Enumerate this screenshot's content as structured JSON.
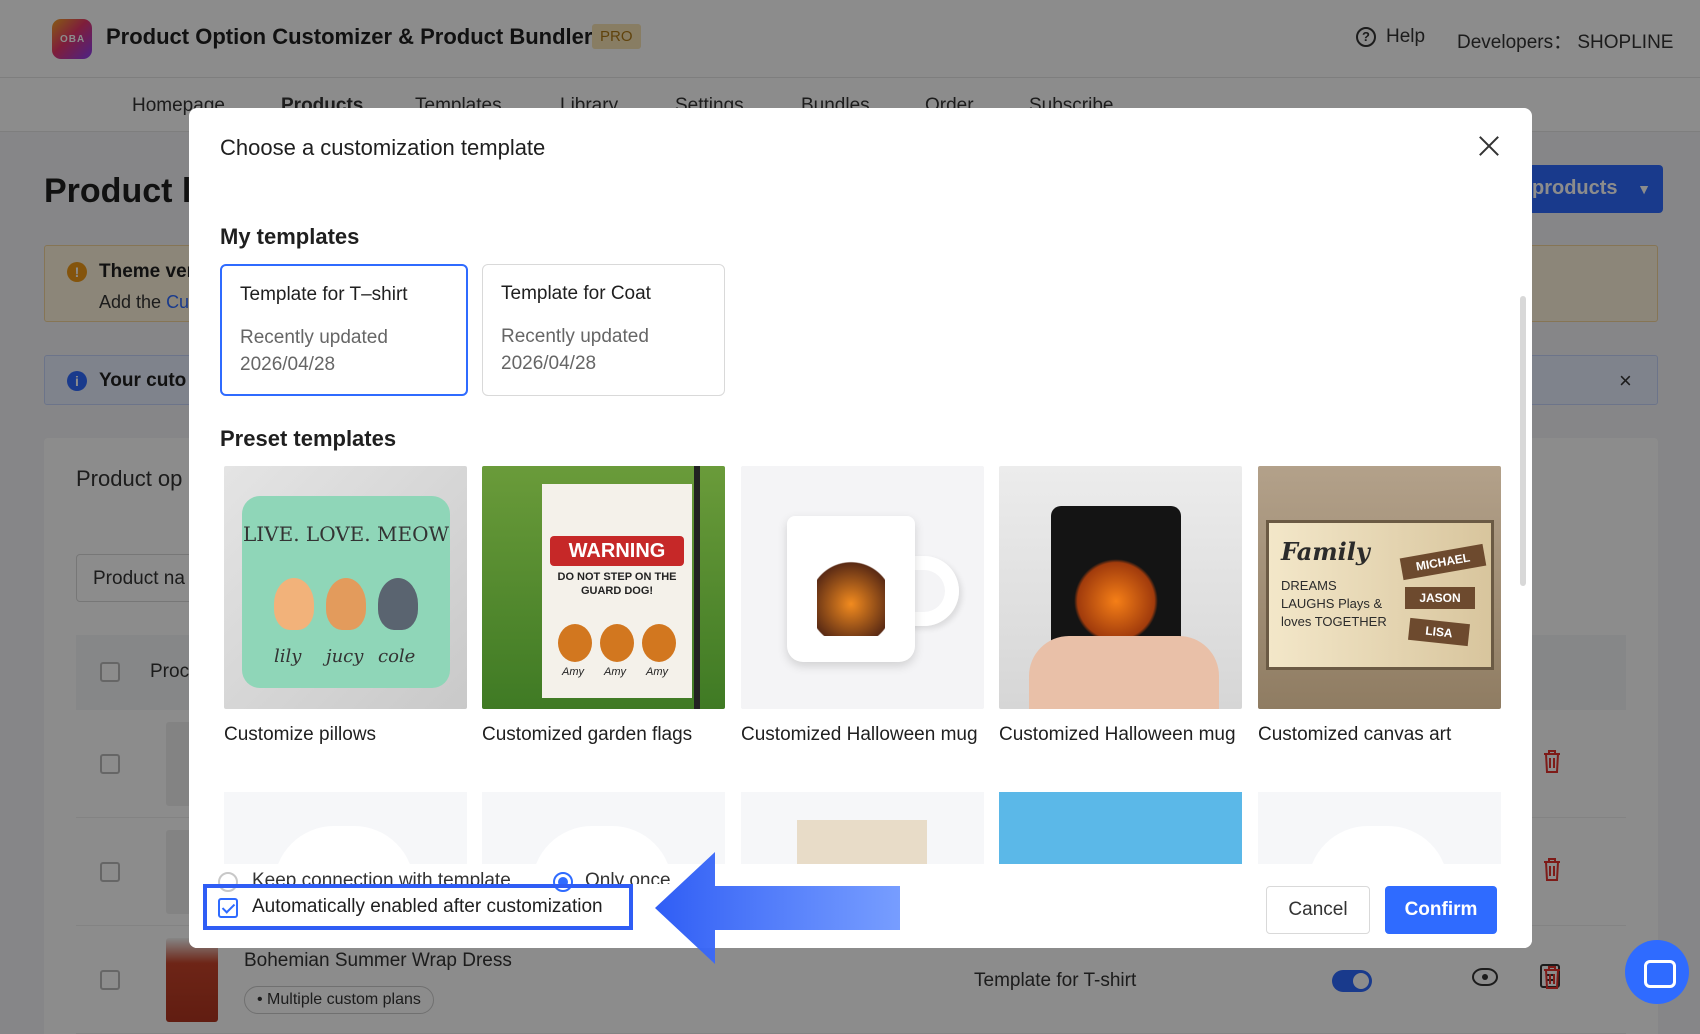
{
  "app": {
    "logo_text": "OBA",
    "title": "Product Option Customizer & Product Bundler",
    "badge": "PRO",
    "help_label": "Help",
    "developer_label": "Developers： SHOPLINE"
  },
  "nav": {
    "items": [
      "Homepage",
      "Products",
      "Templates",
      "Library",
      "Settings",
      "Bundles",
      "Order",
      "Subscribe"
    ]
  },
  "page": {
    "title": "Product li",
    "add_button": "products",
    "warning_title": "Theme ver",
    "warning_sub": "Add the ",
    "warning_link": "Cu",
    "info_title": "Your cuto",
    "list_heading": "Product op",
    "search_placeholder": "Product na",
    "column_product": "Proc"
  },
  "rows": [
    {
      "title": "",
      "template": "",
      "badge": ""
    },
    {
      "title": "",
      "template": "",
      "badge": ""
    },
    {
      "title": "Bohemian Summer Wrap Dress",
      "template": "Template for T-shirt",
      "badge": "• Multiple custom plans"
    }
  ],
  "modal": {
    "title": "Choose a customization template",
    "my_templates_heading": "My templates",
    "preset_heading": "Preset templates",
    "my_templates": [
      {
        "name": "Template for T–shirt",
        "updated_label": "Recently updated",
        "date": "2026/04/28",
        "selected": true
      },
      {
        "name": "Template for Coat",
        "updated_label": "Recently updated",
        "date": "2026/04/28",
        "selected": false
      }
    ],
    "presets": [
      {
        "label": "Customize pillows",
        "image_text": "LIVE. LOVE. MEOW",
        "names": [
          "lily",
          "jucy",
          "cole"
        ]
      },
      {
        "label": "Customized garden flags",
        "image_text": "WARNING",
        "image_sub": "DO NOT STEP ON THE GUARD DOG!",
        "names": [
          "Amy",
          "Amy",
          "Amy"
        ]
      },
      {
        "label": "Customized Halloween mug"
      },
      {
        "label": "Customized Halloween mug"
      },
      {
        "label": "Customized canvas art",
        "image_text": "Family",
        "image_sub": "DREAMS LAUGHS Plays & loves TOGETHER",
        "names": [
          "MICHAEL",
          "JASON",
          "LISA"
        ]
      }
    ],
    "footer": {
      "option_keep": "Keep connection with template",
      "option_once": "Only once",
      "selected_option": "Only once",
      "auto_enable": "Automatically enabled after customization",
      "auto_enable_checked": true,
      "cancel": "Cancel",
      "confirm": "Confirm"
    }
  },
  "colors": {
    "primary": "#2f6bff",
    "highlight": "#2f5df5",
    "danger": "#e5322d",
    "warning": "#f09a16"
  }
}
